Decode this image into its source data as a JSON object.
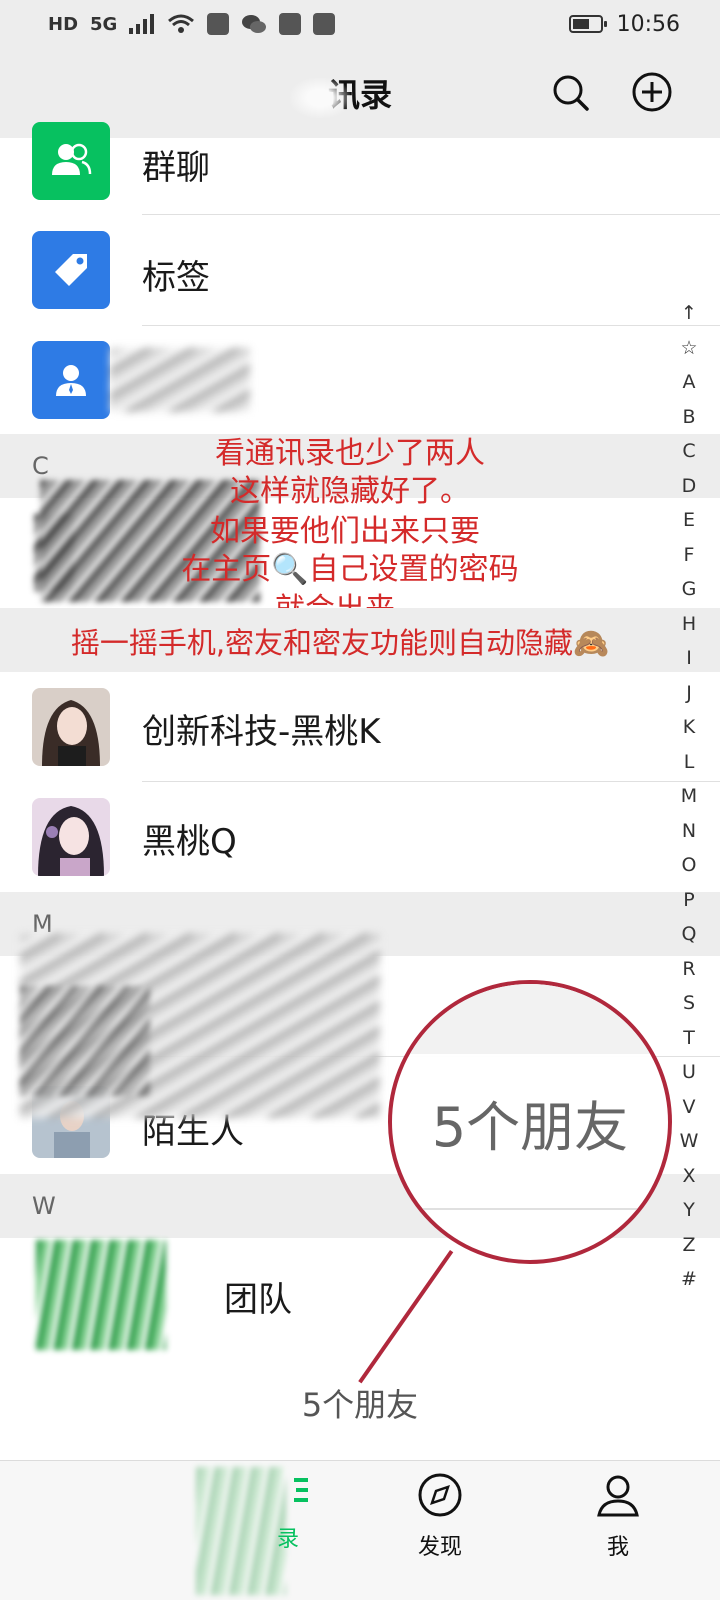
{
  "status_bar": {
    "hd": "HD",
    "network": "5G",
    "time": "10:56",
    "icons": [
      "signal-icon",
      "wifi-icon",
      "notification-icon",
      "wechat-icon",
      "battery-icon"
    ]
  },
  "header": {
    "title_visible": "讯录",
    "search_icon": "search-icon",
    "add_icon": "plus-circle-icon"
  },
  "list": {
    "top_items": [
      {
        "label": "群聊",
        "icon": "group-icon",
        "color": "#07c160"
      },
      {
        "label": "标签",
        "icon": "tag-icon",
        "color": "#2e7be5"
      },
      {
        "label": "",
        "icon": "person-icon",
        "color": "#2e7be5"
      }
    ],
    "sections": [
      {
        "letter": "C"
      },
      {
        "letter": "M"
      },
      {
        "letter": "W"
      }
    ],
    "contacts": [
      {
        "name": "创新科技-黑桃K"
      },
      {
        "name": "黑桃Q"
      },
      {
        "name": "陌生人"
      },
      {
        "name": "团队"
      }
    ]
  },
  "annotation": {
    "lines": [
      "看通讯录也少了两人",
      "这样就隐藏好了。",
      "如果要他们出来只要",
      "在主页🔍自己设置的密码",
      "就会出来。",
      "摇一摇手机,密友和密友功能则自动隐藏🙈"
    ],
    "magnifier_text": "5个朋友",
    "color": "#d42a2a"
  },
  "index_bar": [
    "↑",
    "☆",
    "A",
    "B",
    "C",
    "D",
    "E",
    "F",
    "G",
    "H",
    "I",
    "J",
    "K",
    "L",
    "M",
    "N",
    "O",
    "P",
    "Q",
    "R",
    "S",
    "T",
    "U",
    "V",
    "W",
    "X",
    "Y",
    "Z",
    "#"
  ],
  "footer": {
    "count": "5个朋友"
  },
  "bottom_nav": {
    "items": [
      {
        "label": "录",
        "icon": "contacts-icon",
        "active": true
      },
      {
        "label": "发现",
        "icon": "compass-icon",
        "active": false
      },
      {
        "label": "我",
        "icon": "person-icon",
        "active": false
      }
    ],
    "accent": "#07c160"
  }
}
